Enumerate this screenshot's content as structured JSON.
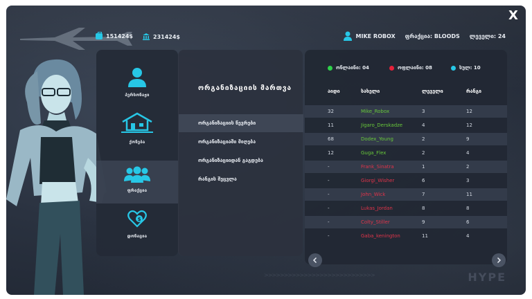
{
  "colors": {
    "accent": "#27c7e6",
    "online": "#2ed14a",
    "offline": "#e5213a",
    "online_name": "#68c93a",
    "offline_name": "#e0344a"
  },
  "window": {
    "close_label": "X"
  },
  "topbar": {
    "cash": "151424$",
    "bank": "231424$",
    "player_name": "MIKE ROBOX",
    "faction": "ფრაქცია: BLOODS",
    "level": "ლეველი: 24"
  },
  "nav": {
    "items": [
      {
        "label": "პერსონაჟი",
        "icon": "person-icon"
      },
      {
        "label": "ქონება",
        "icon": "houses-icon"
      },
      {
        "label": "ფრაქცია",
        "icon": "group-icon"
      },
      {
        "label": "დონაცია",
        "icon": "donation-heart-icon"
      }
    ]
  },
  "menu": {
    "title": "ორგანიზაციის მართვა",
    "items": [
      {
        "label": "ორგანიზაციის წევრები"
      },
      {
        "label": "ორგანიზაციაში მიღება"
      },
      {
        "label": "ორგანიზაციიდან გაგდება"
      },
      {
        "label": "რანგის შეცვლა"
      }
    ]
  },
  "legend": {
    "online": "ონლაინი: 04",
    "offline": "ოფლაინი: 08",
    "total": "სულ: 10"
  },
  "table": {
    "headers": [
      "აიდი",
      "სახელი",
      "ლეველი",
      "რანგი"
    ],
    "rows": [
      {
        "id": "32",
        "name": "Mike_Robox",
        "level": "3",
        "rank": "12",
        "online": true
      },
      {
        "id": "11",
        "name": "Jigaro_Derskadze",
        "level": "4",
        "rank": "12",
        "online": true
      },
      {
        "id": "68",
        "name": "Dodex_Young",
        "level": "2",
        "rank": "9",
        "online": true
      },
      {
        "id": "12",
        "name": "Guga_Flex",
        "level": "2",
        "rank": "4",
        "online": true
      },
      {
        "id": "-",
        "name": "Frank_Sinatra",
        "level": "1",
        "rank": "2",
        "online": false
      },
      {
        "id": "-",
        "name": "Giorgi_Wisher",
        "level": "6",
        "rank": "3",
        "online": false
      },
      {
        "id": "-",
        "name": "John_Wick",
        "level": "7",
        "rank": "11",
        "online": false
      },
      {
        "id": "-",
        "name": "Lukas_Jordan",
        "level": "8",
        "rank": "8",
        "online": false
      },
      {
        "id": "-",
        "name": "Colty_Stiller",
        "level": "9",
        "rank": "6",
        "online": false
      },
      {
        "id": "-",
        "name": "Gaba_kenington",
        "level": "11",
        "rank": "4",
        "online": false
      }
    ]
  },
  "brand": "HYPE"
}
